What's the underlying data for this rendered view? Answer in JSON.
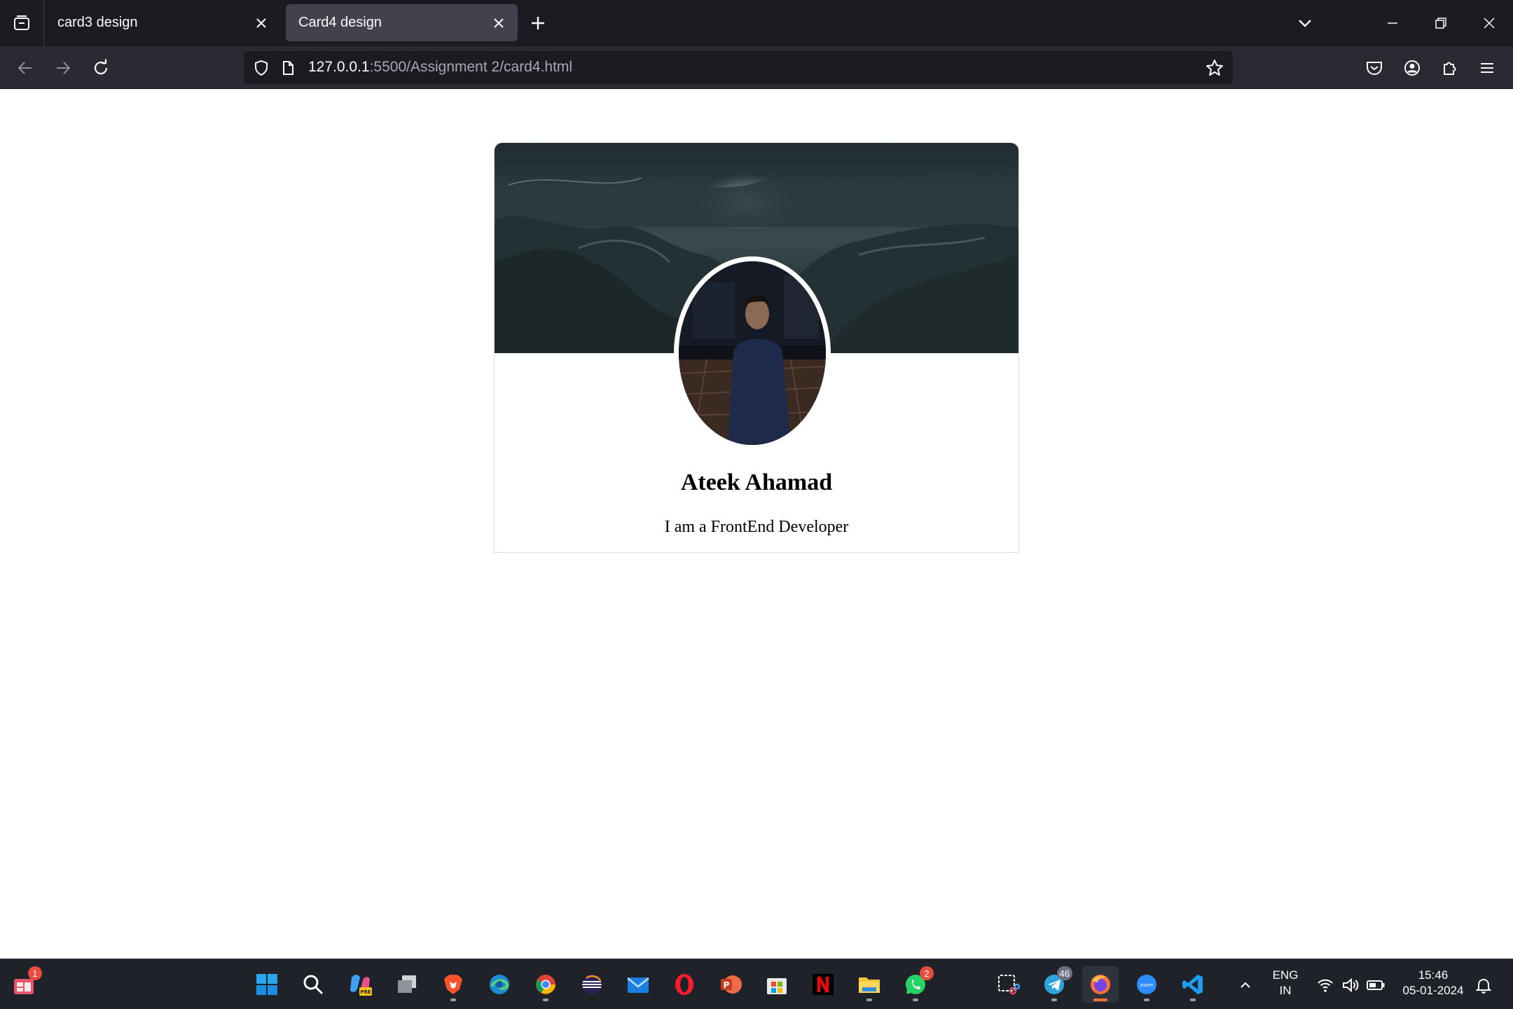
{
  "browser": {
    "tabs": [
      {
        "label": "card3 design",
        "active": false
      },
      {
        "label": "Card4 design",
        "active": true
      }
    ],
    "address": {
      "host": "127.0.0.1",
      "rest": ":5500/Assignment 2/card4.html"
    }
  },
  "card": {
    "name": "Ateek Ahamad",
    "role": "I am a FrontEnd Developer"
  },
  "taskbar": {
    "widgets_badge": "1",
    "whatsapp_badge": "2",
    "telegram_badge": "46",
    "language_line1": "ENG",
    "language_line2": "IN",
    "time": "15:46",
    "date": "05-01-2024"
  },
  "colors": {
    "tabstrip": "#1c1b22",
    "navbar": "#2b2a33",
    "urlbar": "#1c1b22",
    "taskbar": "#1f2329"
  }
}
